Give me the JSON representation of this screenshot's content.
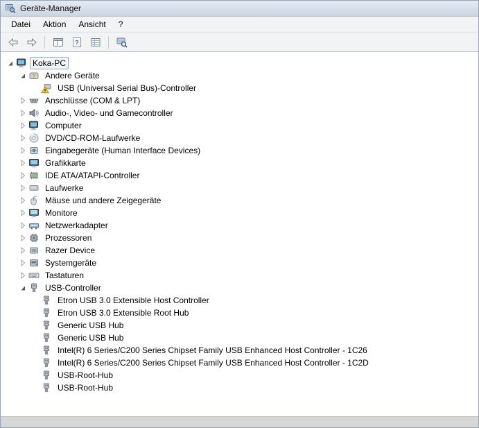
{
  "window": {
    "title": "Geräte-Manager",
    "icon": "device-manager-icon"
  },
  "colors": {
    "titlebar_top": "#e3e9f1",
    "titlebar_bottom": "#ccd6e3",
    "selection_border": "#8da8c4",
    "warning_yellow": "#ffd42a"
  },
  "menubar": {
    "items": [
      {
        "label": "Datei"
      },
      {
        "label": "Aktion"
      },
      {
        "label": "Ansicht"
      },
      {
        "label": "?"
      }
    ]
  },
  "toolbar": {
    "buttons": [
      {
        "name": "back-button",
        "icon": "back-arrow-icon",
        "group": 1
      },
      {
        "name": "forward-button",
        "icon": "forward-arrow-icon",
        "group": 1
      },
      {
        "name": "console-tree-button",
        "icon": "console-tree-icon",
        "group": 2
      },
      {
        "name": "help-button",
        "icon": "help-icon",
        "group": 2
      },
      {
        "name": "properties-button",
        "icon": "properties-icon",
        "group": 2
      },
      {
        "name": "scan-hardware-button",
        "icon": "scan-hardware-icon",
        "group": 3
      }
    ]
  },
  "tree": {
    "items": [
      {
        "label": "Koka-PC",
        "depth": 0,
        "expander": "expanded",
        "icon": "computer-icon",
        "selected": true
      },
      {
        "label": "Andere Geräte",
        "depth": 1,
        "expander": "expanded",
        "icon": "unknown-device-icon"
      },
      {
        "label": "USB (Universal Serial Bus)-Controller",
        "depth": 2,
        "expander": null,
        "icon": "warning-device-icon"
      },
      {
        "label": "Anschlüsse (COM & LPT)",
        "depth": 1,
        "expander": "collapsed",
        "icon": "serial-port-icon"
      },
      {
        "label": "Audio-, Video- und Gamecontroller",
        "depth": 1,
        "expander": "collapsed",
        "icon": "audio-icon"
      },
      {
        "label": "Computer",
        "depth": 1,
        "expander": "collapsed",
        "icon": "computer-icon"
      },
      {
        "label": "DVD/CD-ROM-Laufwerke",
        "depth": 1,
        "expander": "collapsed",
        "icon": "disc-drive-icon"
      },
      {
        "label": "Eingabegeräte (Human Interface Devices)",
        "depth": 1,
        "expander": "collapsed",
        "icon": "hid-icon"
      },
      {
        "label": "Grafikkarte",
        "depth": 1,
        "expander": "collapsed",
        "icon": "display-adapter-icon"
      },
      {
        "label": "IDE ATA/ATAPI-Controller",
        "depth": 1,
        "expander": "collapsed",
        "icon": "storage-controller-icon"
      },
      {
        "label": "Laufwerke",
        "depth": 1,
        "expander": "collapsed",
        "icon": "disk-drive-icon"
      },
      {
        "label": "Mäuse und andere Zeigegeräte",
        "depth": 1,
        "expander": "collapsed",
        "icon": "mouse-icon"
      },
      {
        "label": "Monitore",
        "depth": 1,
        "expander": "collapsed",
        "icon": "monitor-icon"
      },
      {
        "label": "Netzwerkadapter",
        "depth": 1,
        "expander": "collapsed",
        "icon": "network-adapter-icon"
      },
      {
        "label": "Prozessoren",
        "depth": 1,
        "expander": "collapsed",
        "icon": "processor-icon"
      },
      {
        "label": "Razer Device",
        "depth": 1,
        "expander": "collapsed",
        "icon": "generic-device-icon"
      },
      {
        "label": "Systemgeräte",
        "depth": 1,
        "expander": "collapsed",
        "icon": "system-device-icon"
      },
      {
        "label": "Tastaturen",
        "depth": 1,
        "expander": "collapsed",
        "icon": "keyboard-icon"
      },
      {
        "label": "USB-Controller",
        "depth": 1,
        "expander": "expanded",
        "icon": "usb-icon"
      },
      {
        "label": "Etron USB 3.0 Extensible Host Controller",
        "depth": 2,
        "expander": null,
        "icon": "usb-icon"
      },
      {
        "label": "Etron USB 3.0 Extensible Root Hub",
        "depth": 2,
        "expander": null,
        "icon": "usb-icon"
      },
      {
        "label": "Generic USB Hub",
        "depth": 2,
        "expander": null,
        "icon": "usb-icon"
      },
      {
        "label": "Generic USB Hub",
        "depth": 2,
        "expander": null,
        "icon": "usb-icon"
      },
      {
        "label": "Intel(R) 6 Series/C200 Series Chipset Family USB Enhanced Host Controller - 1C26",
        "depth": 2,
        "expander": null,
        "icon": "usb-icon"
      },
      {
        "label": "Intel(R) 6 Series/C200 Series Chipset Family USB Enhanced Host Controller - 1C2D",
        "depth": 2,
        "expander": null,
        "icon": "usb-icon"
      },
      {
        "label": "USB-Root-Hub",
        "depth": 2,
        "expander": null,
        "icon": "usb-icon"
      },
      {
        "label": "USB-Root-Hub",
        "depth": 2,
        "expander": null,
        "icon": "usb-icon"
      }
    ]
  }
}
